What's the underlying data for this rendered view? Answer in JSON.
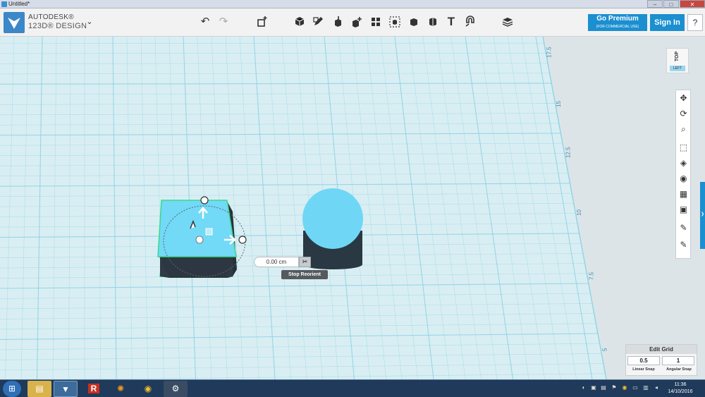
{
  "window": {
    "title": "Untitled*",
    "min": "–",
    "max": "□",
    "close": "✕"
  },
  "brand": {
    "line1": "AUTODESK®",
    "line2": "123D® DESIGN",
    "menu_chevron": "⌄"
  },
  "toolbar": {
    "undo": "↶",
    "redo": "↷",
    "text_tool": "T"
  },
  "premium": {
    "label": "Go Premium",
    "sublabel": "(FOR COMMERCIAL USE)"
  },
  "sign_in": "Sign In",
  "help": "?",
  "viewcube": {
    "top": "TOP",
    "left": "LEFT"
  },
  "ruler": {
    "labels": [
      "17.5",
      "15",
      "12.5",
      "10",
      "7.5",
      "5"
    ]
  },
  "manipulator": {
    "distance_value": "0.00 cm",
    "tooltip": "Stop Reorient"
  },
  "edit_grid": {
    "title": "Edit Grid",
    "linear_snap_value": "0.5",
    "angular_snap_value": "1",
    "linear_snap_label": "Linear Snap",
    "angular_snap_label": "Angular Snap"
  },
  "taskbar": {
    "time": "11:36",
    "date": "14/10/2016"
  },
  "colors": {
    "accent": "#1b8fd0",
    "grid_line": "#8fd3e6",
    "selection": "#58e0a0",
    "shape_fill": "#70d8f5"
  }
}
